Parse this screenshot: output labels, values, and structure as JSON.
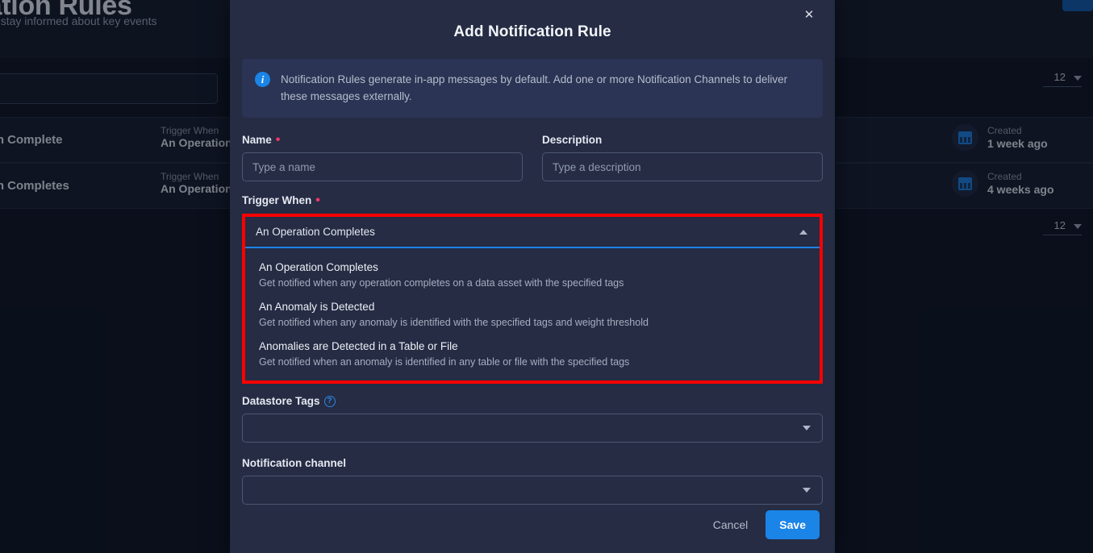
{
  "background": {
    "page_title": "Notification Rules",
    "page_subtitle": "Create rules to stay informed about key events",
    "search_placeholder": "",
    "column_labels": {
      "trigger_when": "Trigger When",
      "created": "Created"
    },
    "rows": [
      {
        "name": "An Operation Complete",
        "trigger_label": "Trigger When",
        "trigger_value": "An Operation Completes",
        "created_label": "Created",
        "created_value": "1 week ago",
        "calendar_icon": "calendar-icon"
      },
      {
        "name": "An Operation Completes",
        "trigger_label": "Trigger When",
        "trigger_value": "An Operation Completes",
        "created_label": "Created",
        "created_value": "4 weeks ago",
        "calendar_icon": "calendar-icon"
      }
    ],
    "pager_top": "12",
    "pager_bottom": "12"
  },
  "modal": {
    "title": "Add Notification Rule",
    "close_icon": "close-icon",
    "info": {
      "icon": "info-icon",
      "text": "Notification Rules generate in-app messages by default. Add one or more Notification Channels to deliver these messages externally."
    },
    "name": {
      "label": "Name",
      "required_marker": "*",
      "value": "",
      "placeholder": "Type a name"
    },
    "description": {
      "label": "Description",
      "value": "",
      "placeholder": "Type a description"
    },
    "trigger_when": {
      "label": "Trigger When",
      "required_marker": "*",
      "selected": "An Operation Completes",
      "caret_icon": "chevron-up-icon",
      "options": [
        {
          "title": "An Operation Completes",
          "description": "Get notified when any operation completes on a data asset with the specified tags"
        },
        {
          "title": "An Anomaly is Detected",
          "description": "Get notified when any anomaly is identified with the specified tags and weight threshold"
        },
        {
          "title": "Anomalies are Detected in a Table or File",
          "description": "Get notified when an anomaly is identified in any table or file with the specified tags"
        }
      ]
    },
    "datastore_tags": {
      "label": "Datastore Tags",
      "help_icon": "help-icon",
      "value": "",
      "caret_icon": "chevron-down-icon"
    },
    "notification_channel": {
      "label": "Notification channel",
      "value": "",
      "caret_icon": "chevron-down-icon"
    },
    "cancel_label": "Cancel",
    "save_label": "Save"
  },
  "colors": {
    "accent_blue": "#1b84e7",
    "highlight_red": "#fe0000",
    "required_pink": "#f5366a",
    "modal_bg": "#252c44",
    "page_bg": "#0d1322"
  }
}
